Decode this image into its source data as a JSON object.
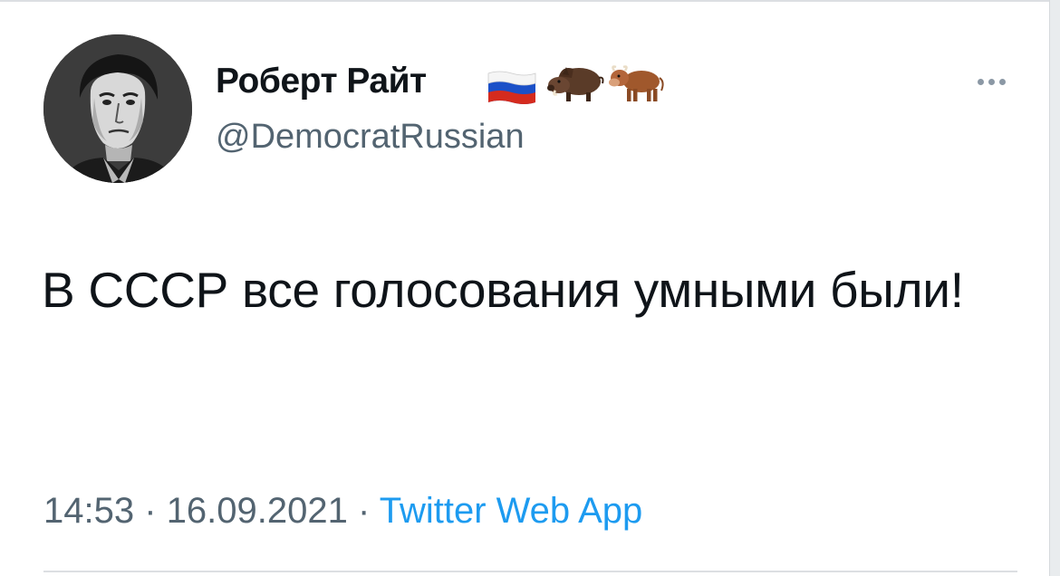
{
  "tweet": {
    "author": {
      "display_name": "Роберт Райт",
      "handle": "@DemocratRussian",
      "name_emojis": [
        "russia-flag-icon",
        "boar-icon",
        "ox-icon"
      ]
    },
    "text": "В СССР все голосования умными были!",
    "time": "14:53",
    "separator": "·",
    "date": "16.09.2021",
    "source": "Twitter Web App"
  },
  "colors": {
    "text": "#0f1419",
    "secondary": "#536471",
    "link": "#1d9bf0",
    "divider": "#dcdfe2"
  }
}
